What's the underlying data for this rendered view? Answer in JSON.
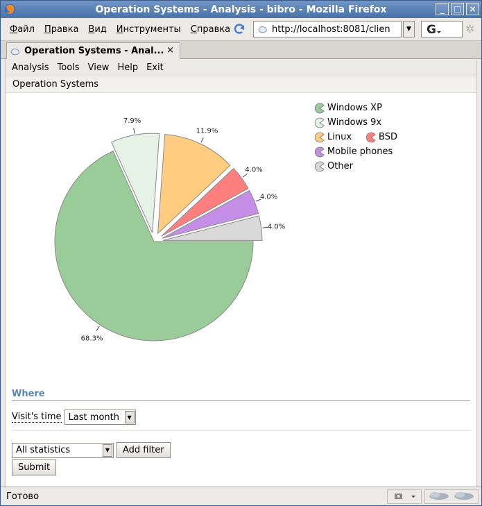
{
  "window": {
    "title": "Operation Systems - Analysis - bibro - Mozilla Firefox",
    "controls": [
      "_",
      "□",
      "×"
    ]
  },
  "browser_menu": [
    {
      "accel": "Ф",
      "rest": "айл"
    },
    {
      "accel": "П",
      "rest": "равка"
    },
    {
      "accel": "В",
      "rest": "ид"
    },
    {
      "accel": "И",
      "rest": "нструменты"
    },
    {
      "accel": "С",
      "rest": "правка"
    }
  ],
  "address_bar": {
    "url": "http://localhost:8081/clien"
  },
  "tab": {
    "title": "Operation Systems - Anal...",
    "close": "×"
  },
  "app_menu": [
    "Analysis",
    "Tools",
    "View",
    "Help",
    "Exit"
  ],
  "page_heading": "Operation Systems",
  "chart_data": {
    "type": "pie",
    "slices": [
      {
        "name": "Windows XP",
        "value": 68.3,
        "label": "68.3%",
        "color": "#99cc99"
      },
      {
        "name": "Windows 9x",
        "value": 7.9,
        "label": "7.9%",
        "color": "#e6f2e6"
      },
      {
        "name": "Linux",
        "value": 11.9,
        "label": "11.9%",
        "color": "#ffcc80"
      },
      {
        "name": "BSD",
        "value": 4.0,
        "label": "4.0%",
        "color": "#ff7f7f"
      },
      {
        "name": "Mobile phones",
        "value": 4.0,
        "label": "4.0%",
        "color": "#c48ee6"
      },
      {
        "name": "Other",
        "value": 4.0,
        "label": "4.0%",
        "color": "#d9d9d9"
      }
    ],
    "exploded": [
      "Windows 9x",
      "Linux",
      "BSD",
      "Mobile phones",
      "Other"
    ],
    "legend_placement": "top-right"
  },
  "filters": {
    "section_title": "Where",
    "visit_time_label": "Visit's time",
    "visit_time_value": "Last month",
    "stats_select_value": "All statistics",
    "add_filter_label": "Add filter",
    "submit_label": "Submit"
  },
  "status": {
    "text": "Готово"
  }
}
